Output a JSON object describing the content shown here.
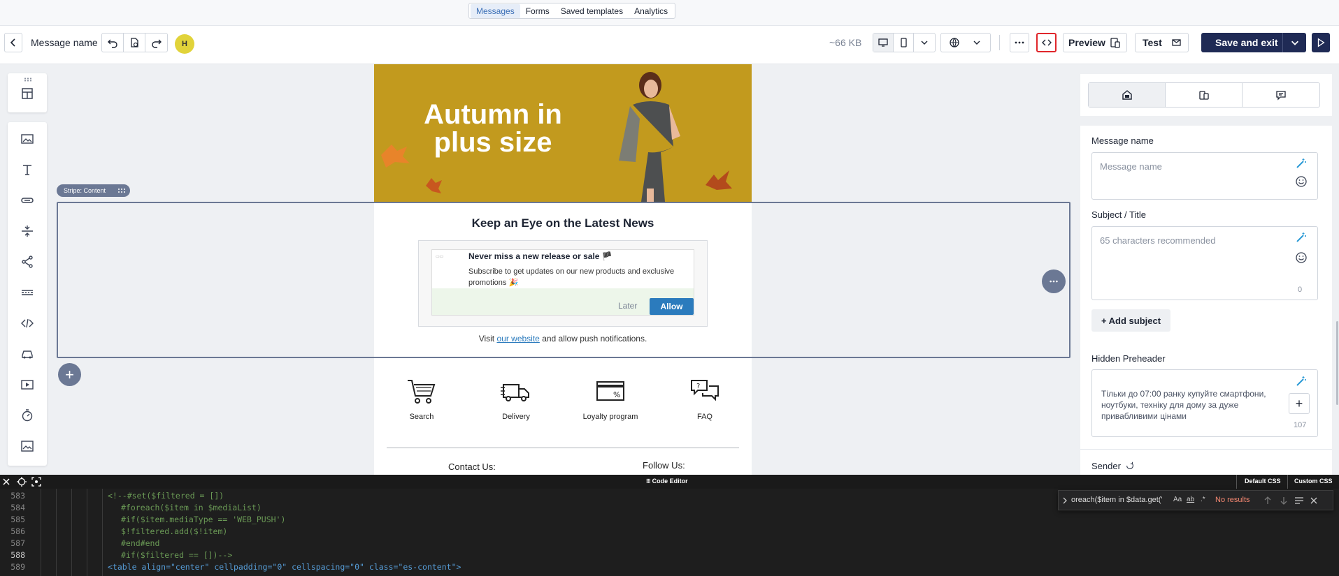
{
  "top_tabs": [
    {
      "label": "Messages",
      "active": true
    },
    {
      "label": "Forms",
      "active": false
    },
    {
      "label": "Saved templates",
      "active": false
    },
    {
      "label": "Analytics",
      "active": false
    }
  ],
  "toolbar": {
    "message_name": "Message name",
    "avatar_initial": "H",
    "size": "~66 KB",
    "preview_label": "Preview",
    "test_label": "Test",
    "save_label": "Save and exit"
  },
  "email": {
    "hero_title": "Autumn in plus size",
    "stripe_label": "Stripe: Content",
    "news_heading": "Keep an Eye on the Latest News",
    "push_title": "Never miss a new release or sale 🏴",
    "push_body": "Subscribe to get updates on our new products and exclusive promotions 🎉",
    "later_label": "Later",
    "allow_label": "Allow",
    "visit_prefix": "Visit ",
    "visit_link": "our website",
    "visit_suffix": " and allow push notifications.",
    "features": [
      {
        "label": "Search",
        "icon": "cart-icon"
      },
      {
        "label": "Delivery",
        "icon": "truck-icon"
      },
      {
        "label": "Loyalty program",
        "icon": "discount-card-icon"
      },
      {
        "label": "FAQ",
        "icon": "chat-bubbles-icon"
      }
    ],
    "contact_label": "Contact Us:",
    "follow_label": "Follow Us:"
  },
  "panel": {
    "message_name_label": "Message name",
    "message_name_placeholder": "Message name",
    "subject_label": "Subject / Title",
    "subject_placeholder": "65 characters recommended",
    "subject_count": "0",
    "add_subject_label": "+ Add subject",
    "preheader_label": "Hidden Preheader",
    "preheader_text": "Тільки до 07:00 ранку купуйте смартфони, ноутбуки, техніку для дому за дуже привабливими цінами",
    "preheader_count": "107",
    "sender_label": "Sender"
  },
  "code_editor": {
    "title": "Code Editor",
    "default_css": "Default CSS",
    "custom_css": "Custom CSS",
    "search_query": "oreach($item in $data.get('",
    "search_result": "No results",
    "lines": [
      {
        "n": "583",
        "text": "<!--#set($filtered = [])"
      },
      {
        "n": "584",
        "text": "#foreach($item in $mediaList)"
      },
      {
        "n": "585",
        "text": "#if($item.mediaType == 'WEB_PUSH')"
      },
      {
        "n": "586",
        "text": "$!filtered.add($!item)"
      },
      {
        "n": "587",
        "text": "#end#end"
      },
      {
        "n": "588",
        "text": "#if($filtered == [])-->"
      },
      {
        "n": "589",
        "text": "<table align=\"center\" cellpadding=\"0\" cellspacing=\"0\" class=\"es-content\">"
      }
    ]
  },
  "colors": {
    "accent": "#1f2a55",
    "stripe": "#6b7894",
    "allow": "#2b7bbd",
    "hero_bg": "#c29a1e"
  }
}
